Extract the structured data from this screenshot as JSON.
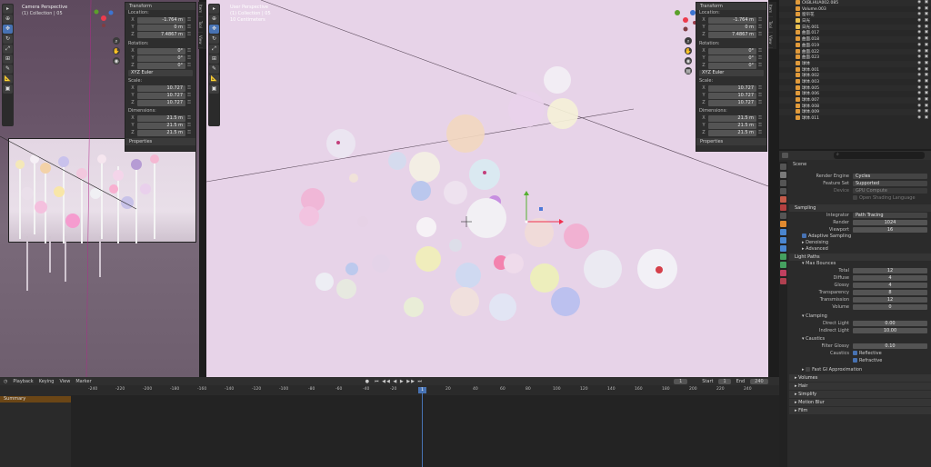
{
  "left_viewport": {
    "view_label": "Camera Perspective",
    "collection_label": "(1) Collection | 05"
  },
  "main_viewport": {
    "overlay_lines": [
      "User Perspective",
      "(1) Collection | 05",
      "10 Centimeters"
    ]
  },
  "view_tabs": [
    "Item",
    "Tool",
    "View"
  ],
  "transform_panel": {
    "header": "Transform",
    "location_label": "Location:",
    "location": [
      {
        "axis": "X",
        "value": "-1.764 m"
      },
      {
        "axis": "Y",
        "value": "0 m"
      },
      {
        "axis": "Z",
        "value": "7.4867 m"
      }
    ],
    "rotation_label": "Rotation:",
    "rotation": [
      {
        "axis": "X",
        "value": "0°"
      },
      {
        "axis": "Y",
        "value": "0°"
      },
      {
        "axis": "Z",
        "value": "0°"
      }
    ],
    "rotation_mode": "XYZ Euler",
    "scale_label": "Scale:",
    "scale": [
      {
        "axis": "X",
        "value": "10.727"
      },
      {
        "axis": "Y",
        "value": "10.727"
      },
      {
        "axis": "Z",
        "value": "10.727"
      }
    ],
    "dimensions_label": "Dimensions:",
    "dimensions": [
      {
        "axis": "X",
        "value": "21.5 m"
      },
      {
        "axis": "Y",
        "value": "21.5 m"
      },
      {
        "axis": "Z",
        "value": "21.5 m"
      }
    ],
    "properties_header": "Properties"
  },
  "outliner": {
    "items": [
      "CKBLHUA002.085",
      "Volume.003",
      "窗帘花",
      "日光",
      "日光.001",
      "曲面.017",
      "曲面.018",
      "曲面.019",
      "曲面.022",
      "曲面.023",
      "球体",
      "球体.001",
      "球体.002",
      "球体.003",
      "球体.005",
      "球体.006",
      "球体.007",
      "球体.008",
      "球体.009",
      "球体.011"
    ]
  },
  "properties": {
    "search_placeholder": "",
    "scene_label": "Scene",
    "render_engine_label": "Render Engine",
    "render_engine": "Cycles",
    "feature_set_label": "Feature Set",
    "feature_set": "Supported",
    "device_label": "Device",
    "device": "GPU Compute",
    "open_shading": "Open Shading Language",
    "sampling": "Sampling",
    "integrator_label": "Integrator",
    "integrator": "Path Tracing",
    "render_label": "Render",
    "render_value": "1024",
    "viewport_label": "Viewport",
    "viewport_value": "16",
    "adaptive_sampling": "Adaptive Sampling",
    "denoising": "Denoising",
    "advanced": "Advanced",
    "light_paths": "Light Paths",
    "max_bounces": "Max Bounces",
    "bounces": [
      {
        "label": "Total",
        "value": "12"
      },
      {
        "label": "Diffuse",
        "value": "4"
      },
      {
        "label": "Glossy",
        "value": "4"
      },
      {
        "label": "Transparency",
        "value": "8"
      },
      {
        "label": "Transmission",
        "value": "12"
      },
      {
        "label": "Volume",
        "value": "0"
      }
    ],
    "clamping": "Clamping",
    "direct_light_label": "Direct Light",
    "direct_light": "0.00",
    "indirect_light_label": "Indirect Light",
    "indirect_light": "10.00",
    "caustics": "Caustics",
    "filter_glossy_label": "Filter Glossy",
    "filter_glossy": "0.10",
    "caustics_label": "Caustics",
    "reflective": "Reflective",
    "refractive": "Refractive",
    "fast_gi": "Fast GI Approximation",
    "volumes": "Volumes",
    "hair": "Hair",
    "simplify": "Simplify",
    "motion_blur": "Motion Blur",
    "film": "Film"
  },
  "timeline": {
    "menus": [
      "Playback",
      "Keying",
      "View",
      "Marker"
    ],
    "summary": "Summary",
    "current_frame": "1",
    "start_label": "Start",
    "start_value": "1",
    "end_label": "End",
    "end_value": "240",
    "ticks": [
      "-240",
      "-220",
      "-200",
      "-180",
      "-160",
      "-140",
      "-120",
      "-100",
      "-80",
      "-60",
      "-40",
      "-20",
      "1",
      "20",
      "40",
      "60",
      "80",
      "100",
      "120",
      "140",
      "160",
      "180",
      "200",
      "220",
      "240"
    ],
    "cursor": "1"
  }
}
